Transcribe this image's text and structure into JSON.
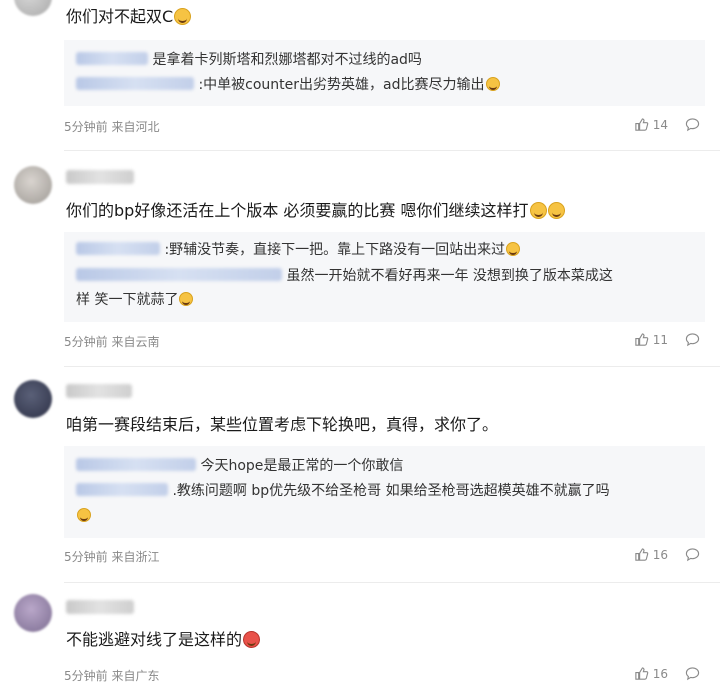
{
  "comments": [
    {
      "text": "你们对不起双C",
      "replies": [
        {
          "text": "是拿着卡列斯塔和烈娜塔都对不过线的ad吗"
        },
        {
          "text": ":中单被counter出劣势英雄，ad比赛尽力输出"
        }
      ],
      "time": "5分钟前",
      "location": "来自河北",
      "likes": "14"
    },
    {
      "text": "你们的bp好像还活在上个版本 必须要赢的比赛 嗯你们继续这样打",
      "replies": [
        {
          "text": ":野辅没节奏，直接下一把。靠上下路没有一回站出来过"
        },
        {
          "text": "虽然一开始就不看好再来一年 没想到换了版本菜成这"
        },
        {
          "text": "样 笑一下就蒜了"
        }
      ],
      "time": "5分钟前",
      "location": "来自云南",
      "likes": "11"
    },
    {
      "text": "咱第一赛段结束后，某些位置考虑下轮换吧，真得，求你了。",
      "replies": [
        {
          "text": "今天hope是最正常的一个你敢信"
        },
        {
          "text": ".教练问题啊 bp优先级不给圣枪哥 如果给圣枪哥选超模英雄不就赢了吗"
        }
      ],
      "time": "5分钟前",
      "location": "来自浙江",
      "likes": "16"
    },
    {
      "text": "不能逃避对线了是这样的",
      "time": "5分钟前",
      "location": "来自广东",
      "likes": "16"
    }
  ],
  "icons": {
    "like": "thumbs-up-icon",
    "reply": "comment-bubble-icon",
    "emoji": "emoji-icon"
  },
  "colors": {
    "reply_bg": "#f6f7f9",
    "meta_text": "#8a8a8a",
    "body_text": "#1a1a1a"
  }
}
